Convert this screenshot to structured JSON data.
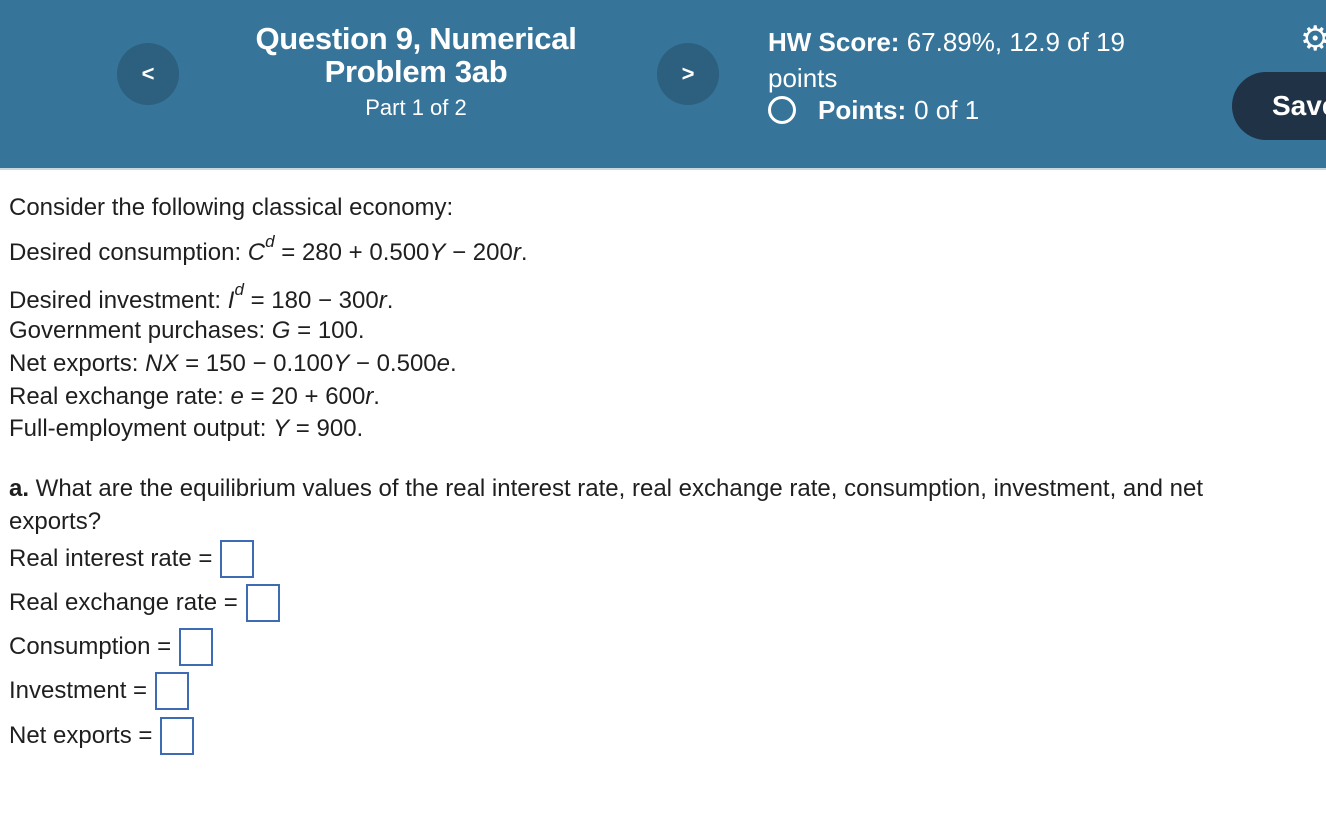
{
  "header": {
    "prev_label": "<",
    "next_label": ">",
    "title": "Question 9, Numerical Problem 3ab",
    "part": "Part 1 of 2",
    "hw_score_label": "HW Score:",
    "hw_score_value": "67.89%, 12.9 of 19 points",
    "points_label": "Points:",
    "points_value": "0 of 1",
    "settings_icon": "gear-icon",
    "save_label": "Save"
  },
  "problem": {
    "intro": "Consider the following classical economy:",
    "consumption": {
      "label": "Desired consumption: ",
      "symbol": "C",
      "sup": "d",
      "rhs_a": " = 280 + 0.500",
      "var1": "Y",
      "rhs_b": " − 200",
      "var2": "r",
      "end": "."
    },
    "investment": {
      "label": "Desired investment: ",
      "symbol": "I",
      "sup": "d",
      "rhs_a": " = 180  − 300",
      "var1": "r",
      "end": "."
    },
    "government": {
      "label": "Government purchases: ",
      "symbol": "G",
      "rhs": " = 100."
    },
    "net_exports": {
      "label": "Net exports: ",
      "symbol": "NX",
      "rhs_a": " = 150  − 0.100",
      "var1": "Y",
      "rhs_b": " − 0.500",
      "var2": "e",
      "end": "."
    },
    "exchange": {
      "label": "Real exchange rate: ",
      "symbol": "e",
      "rhs_a": " = 20 + 600",
      "var1": "r",
      "end": "."
    },
    "output": {
      "label": "Full-employment output: ",
      "symbol": "Y",
      "rhs": " = 900."
    }
  },
  "question": {
    "letter": "a.",
    "text": " What are the equilibrium values of the real interest rate, real exchange rate, consumption, investment, and net exports?"
  },
  "answers": [
    {
      "label": "Real interest rate =",
      "value": ""
    },
    {
      "label": "Real exchange rate =",
      "value": ""
    },
    {
      "label": "Consumption =",
      "value": ""
    },
    {
      "label": "Investment =",
      "value": ""
    },
    {
      "label": "Net exports =",
      "value": ""
    }
  ],
  "colors": {
    "header_bg": "#367499",
    "nav_button_bg": "#2d5f7e",
    "save_button_bg": "#1f3246",
    "answer_box_border": "#3d6cb4"
  }
}
